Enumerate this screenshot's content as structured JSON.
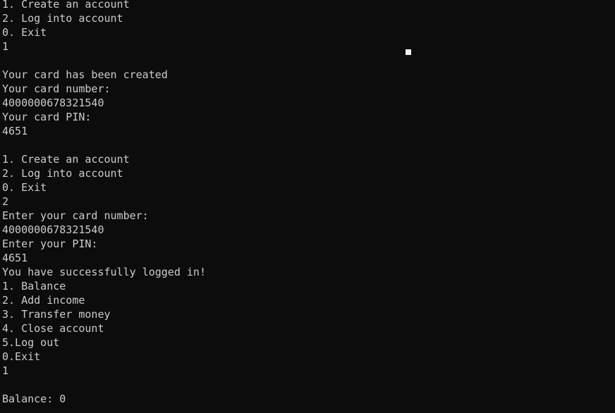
{
  "console": {
    "lines": [
      "1. Create an account",
      "2. Log into account",
      "0. Exit",
      "1",
      "",
      "Your card has been created",
      "Your card number:",
      "4000000678321540",
      "Your card PIN:",
      "4651",
      "",
      "1. Create an account",
      "2. Log into account",
      "0. Exit",
      "2",
      "Enter your card number:",
      "4000000678321540",
      "Enter your PIN:",
      "4651",
      "You have successfully logged in!",
      "1. Balance",
      "2. Add income",
      "3. Transfer money",
      "4. Close account",
      "5.Log out",
      "0.Exit",
      "1",
      "",
      "Balance: 0"
    ]
  },
  "colors": {
    "background": "#0c0c0c",
    "text": "#cccccc",
    "cursor": "#f2f2f2"
  }
}
